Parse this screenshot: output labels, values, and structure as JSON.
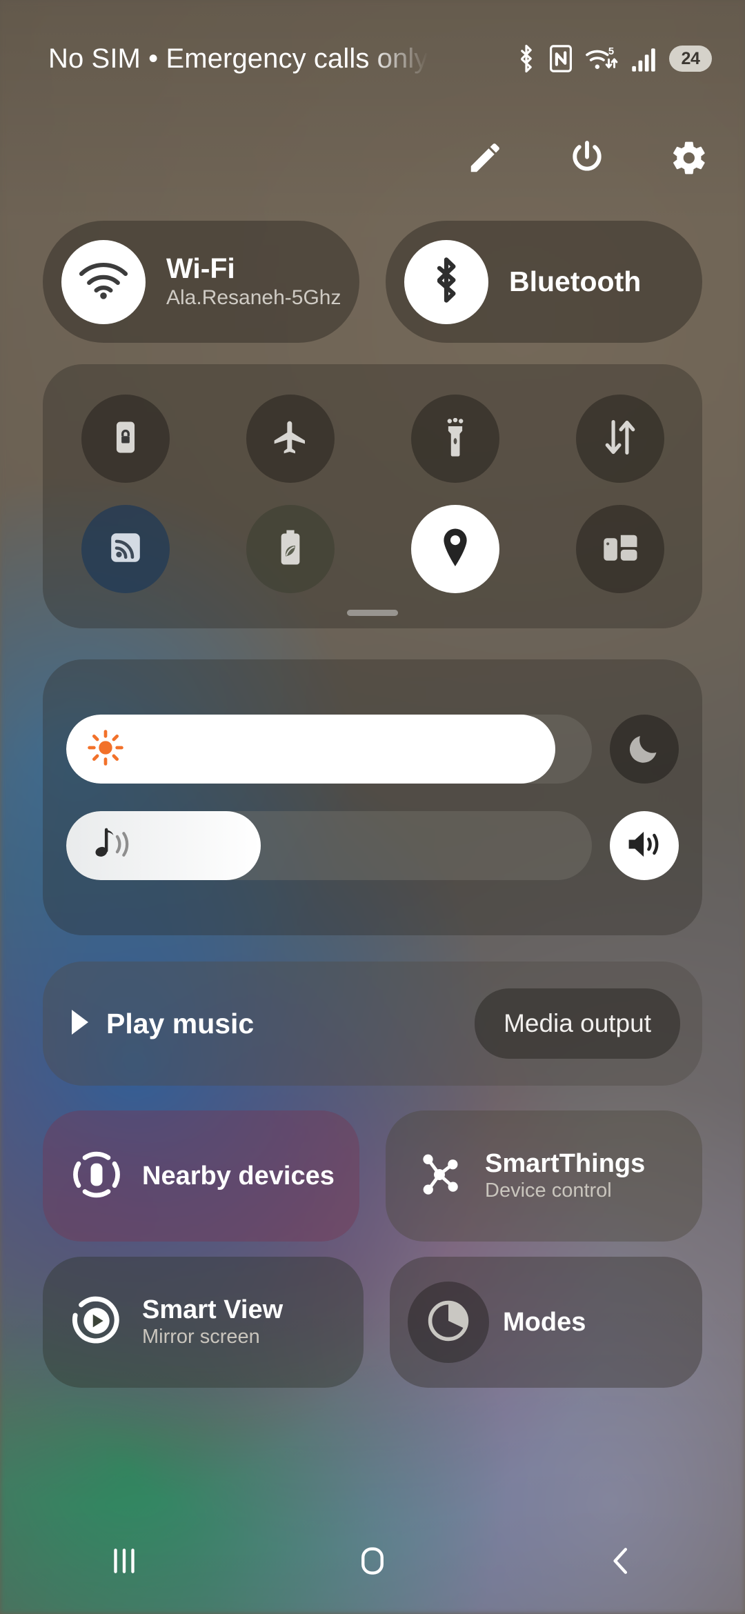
{
  "status_bar": {
    "carrier_text": "No SIM • Emergency calls only",
    "battery_level": "24",
    "icons": [
      "bluetooth-icon",
      "nfc-icon",
      "wifi-5-icon",
      "signal-bars-icon",
      "battery-pill"
    ]
  },
  "header_actions": [
    {
      "name": "edit-button",
      "icon": "pencil-icon"
    },
    {
      "name": "power-button",
      "icon": "power-icon"
    },
    {
      "name": "settings-button",
      "icon": "gear-icon"
    }
  ],
  "top_tiles": [
    {
      "name": "wifi-tile",
      "title": "Wi-Fi",
      "subtitle": "Ala.Resaneh-5Ghz",
      "icon": "wifi-icon",
      "state": "on"
    },
    {
      "name": "bluetooth-tile",
      "title": "Bluetooth",
      "subtitle": "",
      "icon": "bluetooth-icon",
      "state": "on"
    }
  ],
  "toggle_grid": {
    "row1": [
      {
        "name": "auto-rotate-toggle",
        "icon": "rotate-lock-icon",
        "state": "off"
      },
      {
        "name": "airplane-mode-toggle",
        "icon": "airplane-icon",
        "state": "off"
      },
      {
        "name": "flashlight-toggle",
        "icon": "flashlight-icon",
        "state": "off"
      },
      {
        "name": "mobile-data-toggle",
        "icon": "data-arrows-icon",
        "state": "off"
      }
    ],
    "row2": [
      {
        "name": "mobile-hotspot-toggle",
        "icon": "hotspot-icon",
        "state": "off"
      },
      {
        "name": "power-saving-toggle",
        "icon": "battery-leaf-icon",
        "state": "off"
      },
      {
        "name": "location-toggle",
        "icon": "location-pin-icon",
        "state": "on"
      },
      {
        "name": "multi-window-toggle",
        "icon": "multi-window-icon",
        "state": "off"
      }
    ]
  },
  "sliders": {
    "brightness": {
      "name": "brightness-slider",
      "icon": "sun-icon",
      "value": 93,
      "accent": "#f2712a"
    },
    "dark_mode": {
      "name": "dark-mode-button",
      "icon": "moon-icon",
      "state": "off"
    },
    "volume": {
      "name": "volume-slider",
      "icon": "music-note-icon",
      "value": 37
    },
    "sound_mode": {
      "name": "sound-mode-button",
      "icon": "speaker-icon",
      "state": "on"
    }
  },
  "media": {
    "play_label": "Play music",
    "play_icon": "play-icon",
    "media_output_label": "Media output"
  },
  "bottom_tiles": [
    {
      "name": "nearby-devices-tile",
      "title": "Nearby devices",
      "subtitle": "",
      "icon": "nearby-devices-icon"
    },
    {
      "name": "smartthings-tile",
      "title": "SmartThings",
      "subtitle": "Device control",
      "icon": "smartthings-icon"
    },
    {
      "name": "smart-view-tile",
      "title": "Smart View",
      "subtitle": "Mirror screen",
      "icon": "smart-view-icon"
    },
    {
      "name": "modes-tile",
      "title": "Modes",
      "subtitle": "",
      "icon": "modes-pie-icon"
    }
  ],
  "nav_bar": [
    {
      "name": "recents-button",
      "icon": "recents-icon"
    },
    {
      "name": "home-button",
      "icon": "home-icon"
    },
    {
      "name": "back-button",
      "icon": "back-chevron-icon"
    }
  ],
  "colors": {
    "accent_orange": "#f2712a",
    "tile_on": "#ffffff",
    "text_primary": "#ffffff",
    "text_secondary": "#cfcbc4"
  }
}
